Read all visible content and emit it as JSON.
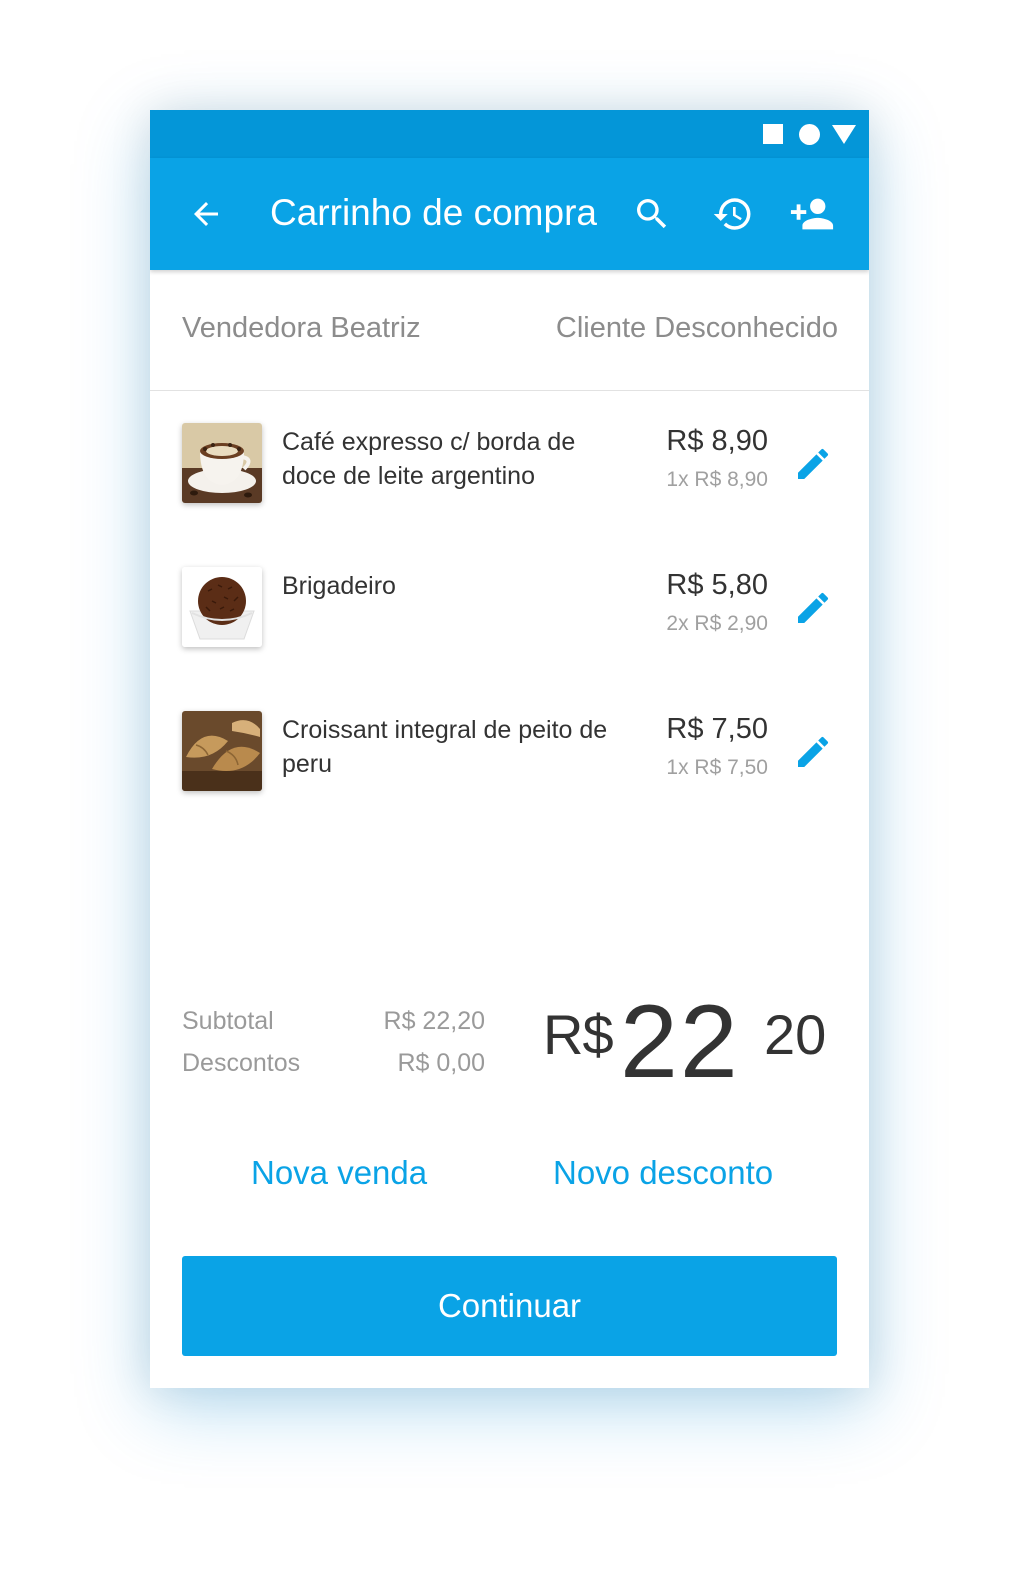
{
  "appbar": {
    "title": "Carrinho de compra",
    "back_icon": "arrow-back-icon",
    "search_icon": "search-icon",
    "history_icon": "history-icon",
    "add_client_icon": "person-add-icon",
    "color": "#0aa3e6"
  },
  "statusbar": {
    "icons": [
      "square-icon",
      "circle-icon",
      "triangle-icon"
    ],
    "color": "#0496d8"
  },
  "header": {
    "seller": "Vendedora Beatriz",
    "client": "Cliente Desconhecido"
  },
  "cart": {
    "items": [
      {
        "name": "Café expresso c/ borda de doce de leite argentino",
        "total": "R$ 8,90",
        "unit": "1x R$ 8,90",
        "image": "coffee-cup-image"
      },
      {
        "name": "Brigadeiro",
        "total": "R$ 5,80",
        "unit": "2x R$ 2,90",
        "image": "brigadeiro-image"
      },
      {
        "name": "Croissant integral de peito de peru",
        "total": "R$ 7,50",
        "unit": "1x R$ 7,50",
        "image": "croissant-image"
      }
    ],
    "edit_icon": "pencil-icon"
  },
  "summary": {
    "subtotal_label": "Subtotal",
    "subtotal_value": "R$ 22,20",
    "discount_label": "Descontos",
    "discount_value": "R$ 0,00",
    "total_currency": "R$",
    "total_integer": "22",
    "total_cents": "20"
  },
  "actions": {
    "new_sale": "Nova venda",
    "new_discount": "Novo desconto",
    "continue": "Continuar"
  }
}
